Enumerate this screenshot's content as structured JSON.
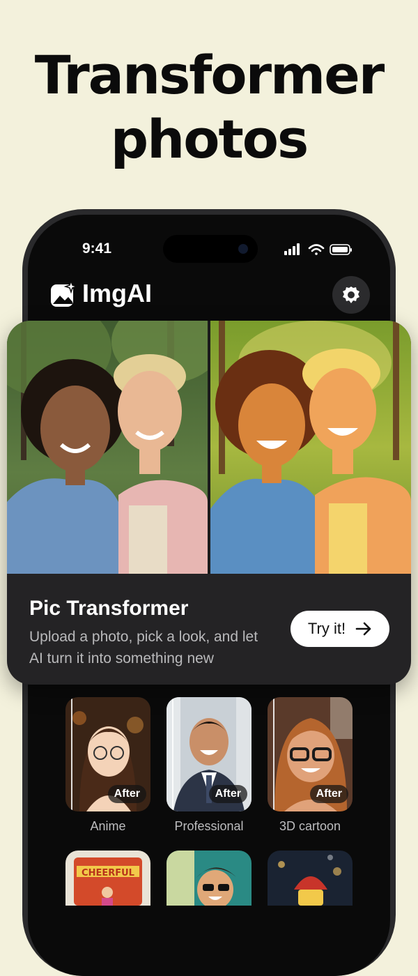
{
  "headline": {
    "line1": "Transformer",
    "line2": "photos"
  },
  "status_bar": {
    "time": "9:41"
  },
  "app": {
    "name": "ImgAI",
    "logo_icon": "image-sparkle-icon",
    "settings_icon": "gear-icon"
  },
  "hero": {
    "title": "Pic Transformer",
    "description": "Upload a photo, pick a look, and let AI turn it into something new",
    "button_label": "Try it!",
    "button_icon": "arrow-right-icon"
  },
  "styles": [
    {
      "label": "Anime",
      "badge": "After"
    },
    {
      "label": "Professional",
      "badge": "After"
    },
    {
      "label": "3D cartoon",
      "badge": "After"
    }
  ],
  "more_styles": [
    {
      "banner_text": "CHEERFUL"
    }
  ],
  "colors": {
    "background": "#f3f1dc",
    "card": "#242325",
    "button": "#ffffff"
  }
}
